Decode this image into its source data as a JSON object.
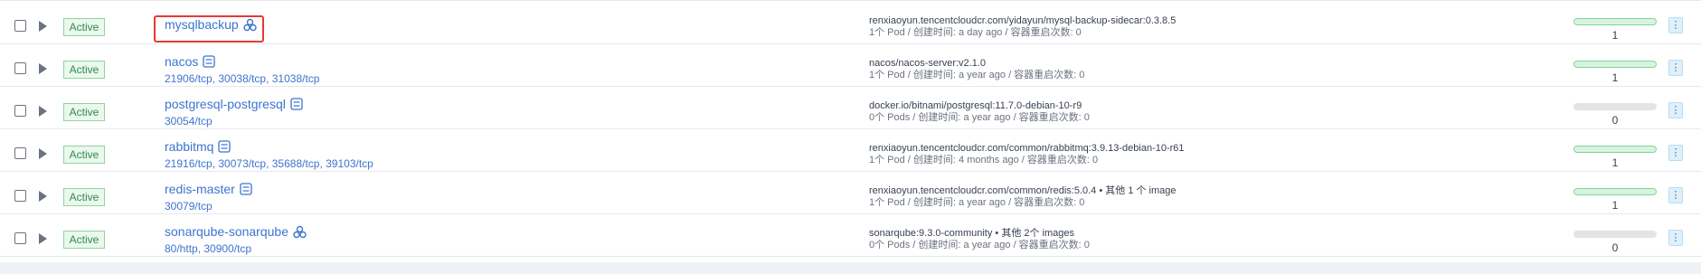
{
  "rows": [
    {
      "status": "Active",
      "name": "mysqlbackup",
      "name_icon": "deployment-cluster-icon",
      "ports": "",
      "image": "renxiaoyun.tencentcloudcr.com/yidayun/mysql-backup-sidecar:0.3.8.5",
      "meta": "1个 Pod / 创建时间: a day ago / 容器重启次数: 0",
      "count": "1",
      "progress": 1.0
    },
    {
      "status": "Active",
      "name": "nacos",
      "name_icon": "service-icon",
      "ports": "21906/tcp, 30038/tcp, 31038/tcp",
      "image": "nacos/nacos-server:v2.1.0",
      "meta": "1个 Pod / 创建时间: a year ago / 容器重启次数: 0",
      "count": "1",
      "progress": 1.0
    },
    {
      "status": "Active",
      "name": "postgresql-postgresql",
      "name_icon": "service-icon",
      "ports": "30054/tcp",
      "image": "docker.io/bitnami/postgresql:11.7.0-debian-10-r9",
      "meta": "0个 Pods / 创建时间: a year ago / 容器重启次数: 0",
      "count": "0",
      "progress": 0.0
    },
    {
      "status": "Active",
      "name": "rabbitmq",
      "name_icon": "service-icon",
      "ports": "21916/tcp, 30073/tcp, 35688/tcp, 39103/tcp",
      "image": "renxiaoyun.tencentcloudcr.com/common/rabbitmq:3.9.13-debian-10-r61",
      "meta": "1个 Pod / 创建时间: 4 months ago / 容器重启次数: 0",
      "count": "1",
      "progress": 1.0
    },
    {
      "status": "Active",
      "name": "redis-master",
      "name_icon": "service-icon",
      "ports": "30079/tcp",
      "image": "renxiaoyun.tencentcloudcr.com/common/redis:5.0.4 • 其他 1 个 image",
      "meta": "1个 Pod / 创建时间: a year ago / 容器重启次数: 0",
      "count": "1",
      "progress": 1.0
    },
    {
      "status": "Active",
      "name": "sonarqube-sonarqube",
      "name_icon": "deployment-cluster-icon",
      "ports": "80/http, 30900/tcp",
      "image": "sonarqube:9.3.0-community • 其他 2个 images",
      "meta": "0个 Pods / 创建时间: a year ago / 容器重启次数: 0",
      "count": "0",
      "progress": 0.0
    }
  ],
  "actions_glyph": "⋮",
  "colors": {
    "link": "#3d74cf",
    "active_bg": "#eaf8ee",
    "active_border": "#8fd4a5",
    "highlight": "#e53935"
  }
}
